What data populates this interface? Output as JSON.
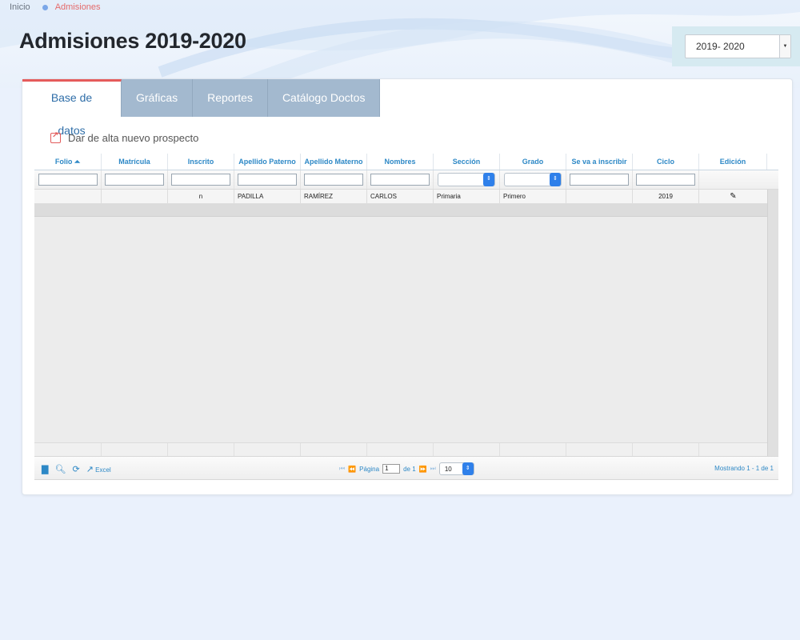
{
  "breadcrumb": {
    "home": "Inicio",
    "current": "Admisiones"
  },
  "page": {
    "title": "Admisiones 2019-2020"
  },
  "cycle_selector": {
    "value": "2019- 2020"
  },
  "tabs": [
    {
      "label": "Base de datos",
      "active": true
    },
    {
      "label": "Gráficas",
      "active": false
    },
    {
      "label": "Reportes",
      "active": false
    },
    {
      "label": "Catálogo Doctos",
      "active": false
    }
  ],
  "actions": {
    "add_prospect": "Dar de alta nuevo prospecto"
  },
  "grid": {
    "columns": [
      {
        "label": "Folio",
        "sort": "asc"
      },
      {
        "label": "Matrícula"
      },
      {
        "label": "Inscrito"
      },
      {
        "label": "Apellido Paterno"
      },
      {
        "label": "Apellido Materno"
      },
      {
        "label": "Nombres"
      },
      {
        "label": "Sección"
      },
      {
        "label": "Grado"
      },
      {
        "label": "Se va a inscribir"
      },
      {
        "label": "Ciclo"
      },
      {
        "label": "Edición"
      }
    ],
    "rows": [
      {
        "folio": "",
        "matricula": "",
        "inscrito": "n",
        "apellido_paterno": "PADILLA",
        "apellido_materno": "RAMÍREZ",
        "nombres": "CARLOS",
        "seccion": "Primaria",
        "grado": "Primero",
        "se_va_a_inscribir": "",
        "ciclo": "2019"
      }
    ]
  },
  "pager": {
    "excel_label": "Excel",
    "page_label": "Página",
    "page_value": "1",
    "of_label": "de 1",
    "rows_per_page": "10",
    "showing": "Mostrando 1 - 1 de 1"
  },
  "colors": {
    "accent_red": "#e55b5b",
    "link_blue": "#2d88c6",
    "tab_inactive": "#a3b9cf",
    "select_blue": "#2f80ea"
  }
}
